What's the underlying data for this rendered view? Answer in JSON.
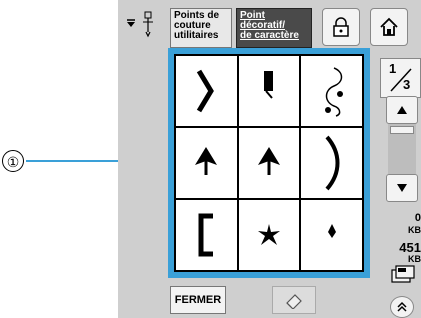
{
  "callout": {
    "number": "①"
  },
  "tabs": {
    "utility": {
      "line1": "Points de",
      "line2": "couture",
      "line3": "utilitaires"
    },
    "decorative": {
      "line1": "Point",
      "line2": "décoratif/",
      "line3": "de caractère"
    }
  },
  "icons": {
    "needle": "needle-icon",
    "lock": "lock-icon",
    "home": "home-icon",
    "eraser": "eraser-icon"
  },
  "page_indicator": {
    "current": "1",
    "total": "3"
  },
  "side": {
    "count": "0",
    "kb1": "KB",
    "memory": "451",
    "kb2": "KB"
  },
  "buttons": {
    "close": "FERMER"
  },
  "stitches": [
    {
      "name": "stitch-cell-r1c1",
      "icon": "right-bracket-stitch"
    },
    {
      "name": "stitch-cell-r1c2",
      "icon": "block-stitch"
    },
    {
      "name": "stitch-cell-r1c3",
      "icon": "swirl-stitch"
    },
    {
      "name": "stitch-cell-r2c1",
      "icon": "leaf-stitch"
    },
    {
      "name": "stitch-cell-r2c2",
      "icon": "leaf-stitch"
    },
    {
      "name": "stitch-cell-r2c3",
      "icon": "right-paren-stitch"
    },
    {
      "name": "stitch-cell-r3c1",
      "icon": "left-bracket-stitch"
    },
    {
      "name": "stitch-cell-r3c2",
      "icon": "star-stitch"
    },
    {
      "name": "stitch-cell-r3c3",
      "icon": "dot-stitch"
    }
  ]
}
